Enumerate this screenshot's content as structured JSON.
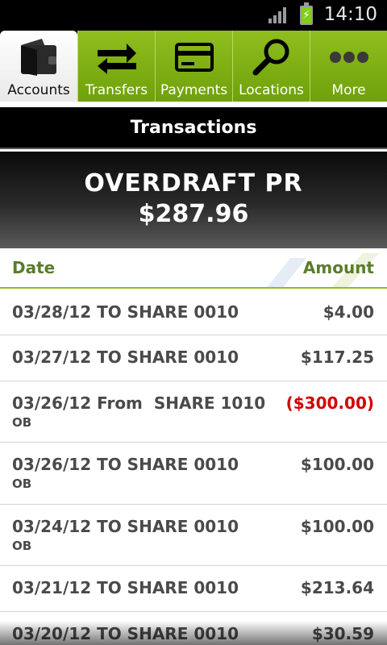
{
  "status_bar": {
    "time": "14:10"
  },
  "tabs": [
    {
      "label": "Accounts",
      "icon": "wallet-icon",
      "active": true
    },
    {
      "label": "Transfers",
      "icon": "transfer-arrows-icon",
      "active": false
    },
    {
      "label": "Payments",
      "icon": "credit-card-icon",
      "active": false
    },
    {
      "label": "Locations",
      "icon": "magnifier-icon",
      "active": false
    },
    {
      "label": "More",
      "icon": "more-dots-icon",
      "active": false
    }
  ],
  "header": {
    "title": "Transactions"
  },
  "account": {
    "name": "OVERDRAFT PR",
    "balance": "$287.96"
  },
  "columns": {
    "date": "Date",
    "amount": "Amount"
  },
  "colors": {
    "accent_green": "#8fbe1e",
    "header_green_text": "#5a7d2a",
    "negative_red": "#d40000"
  },
  "transactions": [
    {
      "description": "03/28/12 TO SHARE 0010",
      "sub": "",
      "amount": "$4.00"
    },
    {
      "description": "03/27/12 TO SHARE 0010",
      "sub": "",
      "amount": "$117.25"
    },
    {
      "description": "03/26/12 From  SHARE 1010",
      "sub": "OB",
      "amount": "($300.00)",
      "negative": true
    },
    {
      "description": "03/26/12 TO SHARE 0010",
      "sub": "OB",
      "amount": "$100.00"
    },
    {
      "description": "03/24/12 TO SHARE 0010",
      "sub": "OB",
      "amount": "$100.00"
    },
    {
      "description": "03/21/12 TO SHARE 0010",
      "sub": "",
      "amount": "$213.64"
    },
    {
      "description": "03/20/12 TO SHARE 0010",
      "sub": "",
      "amount": "$30.59"
    }
  ]
}
